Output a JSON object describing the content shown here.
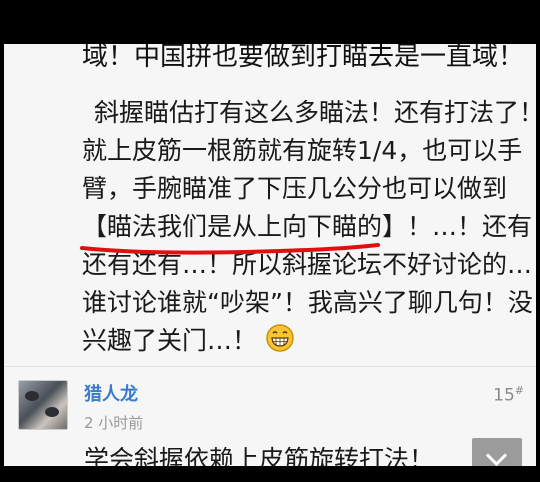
{
  "post": {
    "cut_line": "域！中国拼也要做到打瞄去是一直域！",
    "line1": "斜握瞄估打有这么多瞄法！还有打法了！",
    "line2": "就上皮筋一根筋就有旋转1/4，也可以手",
    "line3": "臂，手腕瞄准了下压几公分也可以做到",
    "line4_highlight": "【瞄法我们是从上向下瞄的】",
    "line4_rest": "！…！还有",
    "line5": "还有还有…！所以斜握论坛不好讨论的…！",
    "line6": "谁讨论谁就“吵架”！我高兴了聊几句！没",
    "line7": "兴趣了关门…！",
    "emoji": "grin-emoji"
  },
  "reply": {
    "author": "猎人龙",
    "time": "2 小时前",
    "floor_number": "15",
    "floor_suffix": "#",
    "text": "学会斜握依赖上皮筋旋转打法！"
  },
  "colors": {
    "underline": "#e01010",
    "author": "#3a7bd0",
    "background": "#f6f6f6"
  }
}
